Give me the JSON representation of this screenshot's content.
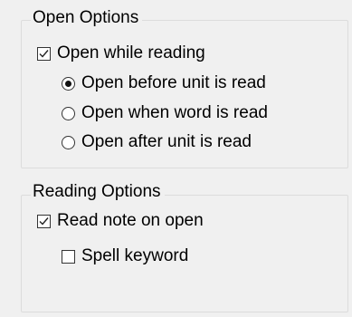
{
  "open_options": {
    "title": "Open Options",
    "open_while_reading": {
      "label": "Open while reading",
      "checked": true
    },
    "radios": [
      {
        "label": "Open before unit is read",
        "selected": true
      },
      {
        "label": "Open when word is read",
        "selected": false
      },
      {
        "label": "Open after unit is read",
        "selected": false
      }
    ]
  },
  "reading_options": {
    "title": "Reading Options",
    "read_note_on_open": {
      "label": "Read note on open",
      "checked": true
    },
    "spell_keyword": {
      "label": "Spell keyword",
      "checked": false
    }
  }
}
